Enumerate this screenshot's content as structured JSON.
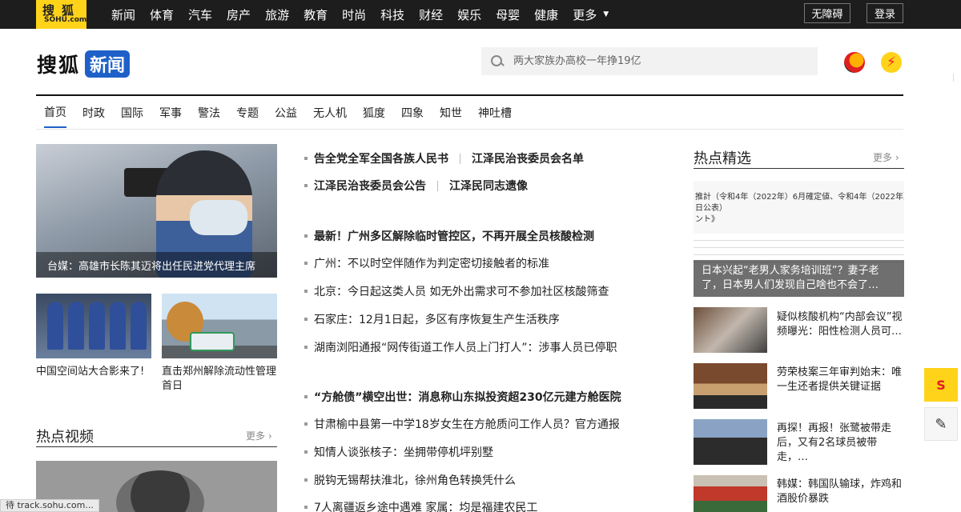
{
  "topbar": {
    "logo_line1": "搜狐",
    "logo_line2": "SOHU.com",
    "nav": [
      "新闻",
      "体育",
      "汽车",
      "房产",
      "旅游",
      "教育",
      "时尚",
      "科技",
      "财经",
      "娱乐",
      "母婴",
      "健康",
      "更多"
    ],
    "accessibility_label": "无障碍",
    "login_label": "登录"
  },
  "brand": {
    "sohu": "搜狐",
    "news": "新闻"
  },
  "search": {
    "placeholder": "两大家族办高校一年挣19亿"
  },
  "subnav": [
    "首页",
    "时政",
    "国际",
    "军事",
    "警法",
    "专题",
    "公益",
    "无人机",
    "狐度",
    "四象",
    "知世",
    "神吐槽"
  ],
  "left": {
    "hero_caption": "台媒：高雄市长陈其迈将出任民进党代理主席",
    "thumbs": [
      {
        "caption": "中国空间站大合影来了!"
      },
      {
        "caption": "直击郑州解除流动性管理首日"
      }
    ],
    "video_section_title": "热点视频",
    "more_label": "更多 ›"
  },
  "middle": {
    "line1": [
      "告全党全军全国各族人民书",
      "江泽民治丧委员会名单"
    ],
    "line2": [
      "江泽民治丧委员会公告",
      "江泽民同志遗像"
    ],
    "headline2": "最新！广州多区解除临时管控区，不再开展全员核酸检测",
    "items1": [
      "广州：不以时空伴随作为判定密切接触者的标准",
      "北京：今日起这类人员 如无外出需求可不参加社区核酸筛查",
      "石家庄：12月1日起，多区有序恢复生产生活秩序",
      "湖南浏阳通报“网传街道工作人员上门打人”：涉事人员已停职"
    ],
    "headline3": "“方舱债”横空出世：消息称山东拟投资超230亿元建方舱医院",
    "items2": [
      "甘肃榆中县第一中学18岁女生在方舱质问工作人员？官方通报",
      "知情人谈张核子：坐拥带停机坪别墅",
      "脱钩无锡帮扶淮北，徐州角色转换凭什么",
      "7人离疆返乡途中遇难 家属：均是福建农民工"
    ]
  },
  "right": {
    "section_title": "热点精选",
    "more_label": "更多 ›",
    "feature_doc_line1": "推計（令和4年（2022年）6月確定値、令和4年（2022年）11月",
    "feature_doc_line2": "日公表）",
    "feature_doc_line3": "ント》",
    "feature_caption": "日本兴起“老男人家务培训班”？妻子老了，日本男人们发现自己啥也不会了…",
    "items": [
      "疑似核酸机构“内部会议”视频曝光：阳性检测人员可…",
      "劳荣枝案三年审判始末：唯一生还者提供关键证据",
      "再探！再报！张鹭被带走后，又有2名球员被带走，…",
      "韩媒：韩国队输球，炸鸡和酒股价暴跌"
    ]
  },
  "floating": {
    "sohu_icon": "S",
    "edit_icon": "✎"
  },
  "status_bar": "待 track.sohu.com...",
  "colors": {
    "topbar": "#1d1d1d",
    "logo": "#ffd31a",
    "brand_blue": "#1e60c8"
  }
}
